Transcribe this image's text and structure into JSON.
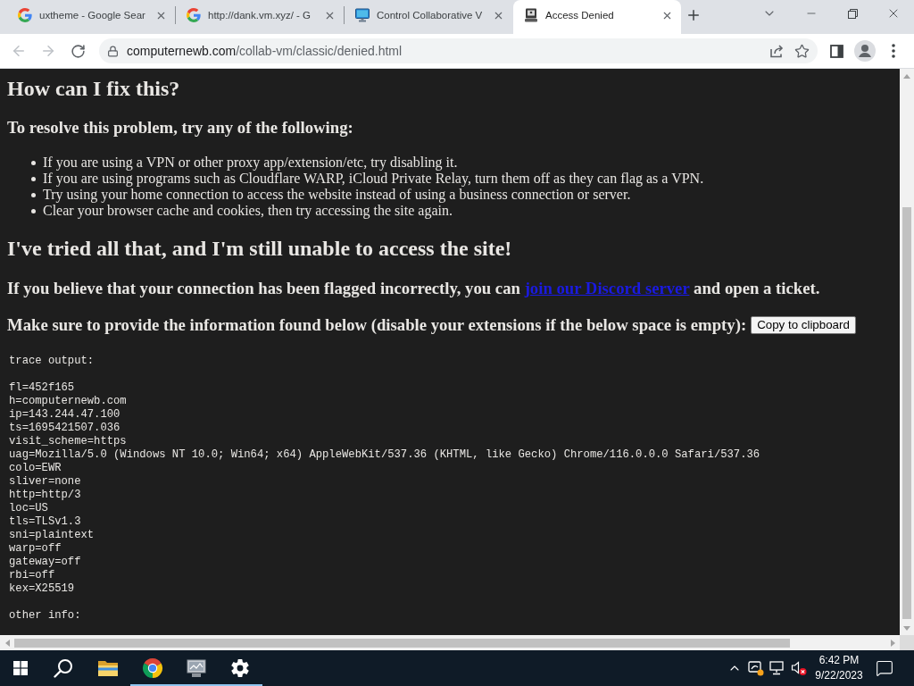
{
  "browser": {
    "tabs": [
      {
        "title": "uxtheme - Google Sear",
        "kind": "google",
        "selected": false
      },
      {
        "title": "http://dank.vm.xyz/ - G",
        "kind": "google",
        "selected": false
      },
      {
        "title": "Control Collaborative V",
        "kind": "monitor",
        "selected": false
      },
      {
        "title": "Access Denied",
        "kind": "computer",
        "selected": true
      }
    ],
    "nav_buttons": [
      {
        "kind": "back",
        "disabled": true
      },
      {
        "kind": "forward",
        "disabled": true
      },
      {
        "kind": "reload",
        "disabled": false
      }
    ],
    "address": {
      "host": "computernewb.com",
      "path": "/collab-vm/classic/denied.html"
    }
  },
  "page": {
    "fix_heading": "How can I fix this?",
    "resolve_heading": "To resolve this problem, try any of the following:",
    "suggestions": [
      "If you are using a VPN or other proxy app/extension/etc, try disabling it.",
      "If you are using programs such as Cloudflare WARP, iCloud Private Relay, turn them off as they can flag as a VPN.",
      "Try using your home connection to access the website instead of using a business connection or server.",
      "Clear your browser cache and cookies, then try accessing the site again."
    ],
    "still_heading": "I've tried all that, and I'm still unable to access the site!",
    "contact": {
      "before": "If you believe that your connection has been flagged incorrectly, you can",
      "link": "join our Discord server",
      "after": "and open a ticket."
    },
    "provide": {
      "text": "Make sure to provide the information found below (disable your extensions if the below space is empty):",
      "button": "Copy to clipboard"
    },
    "trace": {
      "title": "trace output:",
      "lines": [
        "fl=452f165",
        "h=computernewb.com",
        "ip=143.244.47.100",
        "ts=1695421507.036",
        "visit_scheme=https",
        "uag=Mozilla/5.0 (Windows NT 10.0; Win64; x64) AppleWebKit/537.36 (KHTML, like Gecko) Chrome/116.0.0.0 Safari/537.36",
        "colo=EWR",
        "sliver=none",
        "http=http/3",
        "loc=US",
        "tls=TLSv1.3",
        "sni=plaintext",
        "warp=off",
        "gateway=off",
        "rbi=off",
        "kex=X25519"
      ],
      "footer": "other info:"
    }
  },
  "taskbar": {
    "apps": [
      {
        "kind": "start",
        "running": false
      },
      {
        "kind": "search",
        "running": false
      },
      {
        "kind": "explorer",
        "running": false
      },
      {
        "kind": "browser",
        "running": true
      },
      {
        "kind": "vm",
        "running": true
      },
      {
        "kind": "settings",
        "running": true
      }
    ],
    "clock": {
      "time": "6:42 PM",
      "date": "9/22/2023"
    }
  }
}
